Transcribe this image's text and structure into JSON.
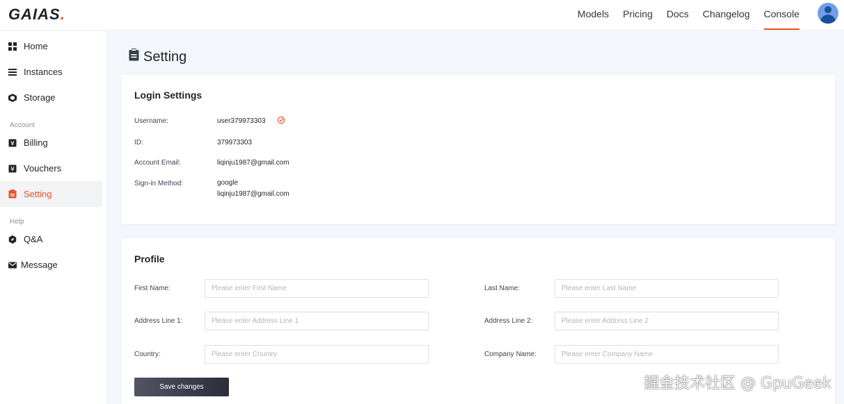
{
  "brand": {
    "name": "GAIAS",
    "dot": "."
  },
  "topnav": {
    "items": [
      "Models",
      "Pricing",
      "Docs",
      "Changelog",
      "Console"
    ],
    "active": "Console"
  },
  "sidebar": {
    "items": [
      {
        "label": "Home",
        "icon": "grid-icon"
      },
      {
        "label": "Instances",
        "icon": "list-icon"
      },
      {
        "label": "Storage",
        "icon": "cube-icon"
      }
    ],
    "account_section": "Account",
    "account_items": [
      {
        "label": "Billing",
        "icon": "yen-icon"
      },
      {
        "label": "Vouchers",
        "icon": "yen-icon"
      },
      {
        "label": "Setting",
        "icon": "clipboard-icon"
      }
    ],
    "help_section": "Help",
    "help_items": [
      {
        "label": "Q&A",
        "icon": "compass-icon"
      },
      {
        "label": "Message",
        "icon": "mail-icon"
      }
    ]
  },
  "page": {
    "title": "Setting"
  },
  "login_settings": {
    "title": "Login Settings",
    "username_label": "Username:",
    "username": "user379973303",
    "id_label": "ID:",
    "id": "379973303",
    "email_label": "Account Email:",
    "email": "liqinju1987@gmail.com",
    "signin_label": "Sign-in Method:",
    "signin_provider": "google",
    "signin_email": "liqinju1987@gmail.com"
  },
  "profile": {
    "title": "Profile",
    "first_name_label": "First Name:",
    "first_name_placeholder": "Please enter First Name",
    "last_name_label": "Last Name:",
    "last_name_placeholder": "Please enter Last Name",
    "address1_label": "Address Line 1:",
    "address1_placeholder": "Please enter Address Line 1",
    "address2_label": "Address Line 2:",
    "address2_placeholder": "Please enter Address Line 2",
    "country_label": "Country:",
    "country_placeholder": "Please enter Country",
    "company_label": "Company Name:",
    "company_placeholder": "Please enter Company Name",
    "save_label": "Save changes"
  },
  "watermark": "掘金技术社区 @ GpuGeek",
  "colors": {
    "accent": "#e8512b",
    "text": "#1f2329",
    "muted": "#86909c"
  }
}
